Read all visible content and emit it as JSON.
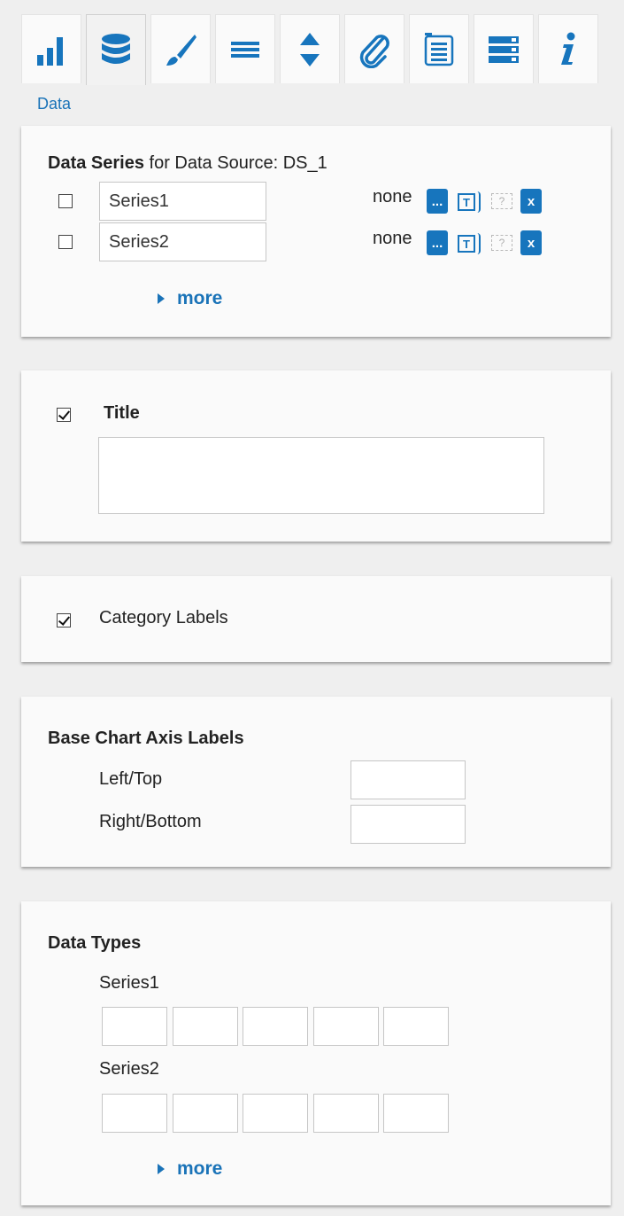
{
  "tabs": [
    {
      "icon": "bar-chart-icon"
    },
    {
      "icon": "database-icon",
      "active": true
    },
    {
      "icon": "brush-icon"
    },
    {
      "icon": "lines-icon"
    },
    {
      "icon": "sort-arrows-icon"
    },
    {
      "icon": "paperclip-icon"
    },
    {
      "icon": "list-icon"
    },
    {
      "icon": "server-rows-icon"
    },
    {
      "icon": "info-icon"
    }
  ],
  "section": "Data",
  "data_series": {
    "heading_bold": "Data Series",
    "heading_rest": "for Data Source: DS_1",
    "rows": [
      {
        "value": "Series1",
        "status": "none",
        "browse": "...",
        "text_btn": "T",
        "help": "?",
        "remove": "x"
      },
      {
        "value": "Series2",
        "status": "none",
        "browse": "...",
        "text_btn": "T",
        "help": "?",
        "remove": "x"
      }
    ],
    "more": "more"
  },
  "title_panel": {
    "label": "Title",
    "value": ""
  },
  "category_panel": {
    "label": "Category Labels"
  },
  "axis_panel": {
    "heading": "Base Chart Axis Labels",
    "left_top": "Left/Top",
    "right_bottom": "Right/Bottom"
  },
  "types_panel": {
    "heading": "Data Types",
    "series1": "Series1",
    "series2": "Series2",
    "more": "more"
  },
  "colors": {
    "accent": "#1775bd"
  }
}
